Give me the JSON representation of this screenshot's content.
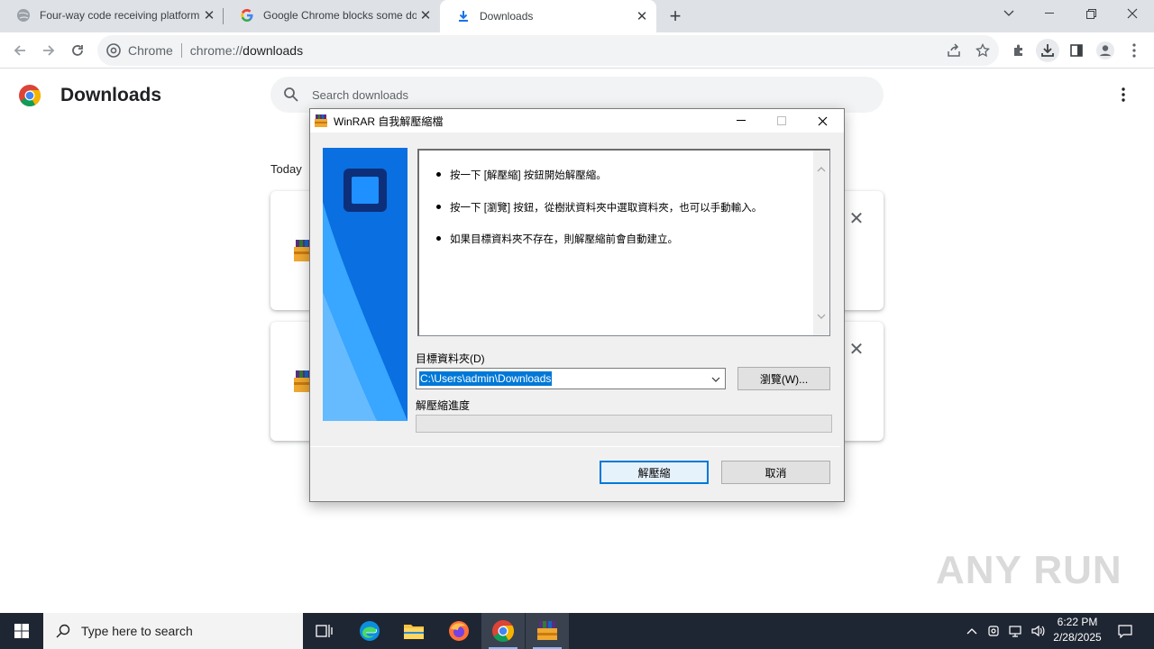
{
  "browser": {
    "tabs": [
      {
        "title": "Four-way code receiving platform",
        "active": false
      },
      {
        "title": "Google Chrome blocks some do",
        "active": false
      },
      {
        "title": "Downloads",
        "active": true
      }
    ],
    "omnibox": {
      "label": "Chrome",
      "scheme": "chrome://",
      "host": "downloads"
    }
  },
  "downloads_page": {
    "title": "Downloads",
    "search_placeholder": "Search downloads",
    "section_today": "Today"
  },
  "dialog": {
    "title": "WinRAR 自我解壓縮檔",
    "instructions": [
      "按一下 [解壓縮] 按鈕開始解壓縮。",
      "按一下 [瀏覽] 按鈕，從樹狀資料夾中選取資料夾，也可以手動輸入。",
      "如果目標資料夾不存在，則解壓縮前會自動建立。"
    ],
    "dest_label": "目標資料夾(D)",
    "dest_value": "C:\\Users\\admin\\Downloads",
    "browse_button": "瀏覽(W)...",
    "progress_label": "解壓縮進度",
    "progress_fraction": 0,
    "extract_button": "解壓縮",
    "cancel_button": "取消"
  },
  "taskbar": {
    "search_placeholder": "Type here to search",
    "time": "6:22 PM",
    "date": "2/28/2025"
  },
  "watermark": "ANY RUN"
}
